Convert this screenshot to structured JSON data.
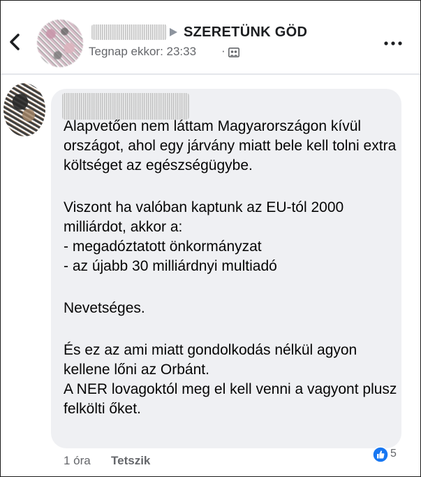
{
  "header": {
    "group_name": "SZERETÜNK GÖD",
    "timestamp": "Tegnap ekkor: 23:33",
    "separator": "·",
    "icons": {
      "back": "chevron-left-icon",
      "arrow": "triangle-right-icon",
      "audience": "group-icon",
      "more": "more-dots-icon"
    }
  },
  "comment": {
    "paragraphs": [
      "Alapvetően nem láttam Magyarországon kívül országot, ahol egy járvány miatt bele kell tolni extra költséget az egészségügybe.",
      "Viszont ha valóban kaptunk az EU-tól 2000 milliárdot, akkor a:",
      "- megadóztatott önkormányzat",
      "- az újabb 30 milliárdnyi multiadó",
      "Nevetséges.",
      "És ez az ami miatt gondolkodás nélkül agyon kellene lőni az Orbánt.",
      "A NER lovagoktól meg el kell venni a vagyont plusz felkölti őket."
    ],
    "bubble_color": "#eff0f3"
  },
  "footer": {
    "time": "1 óra",
    "like_label": "Tetszik",
    "reaction_count": "5",
    "reaction_icon": "like-thumb-icon",
    "like_color": "#1877f2"
  }
}
